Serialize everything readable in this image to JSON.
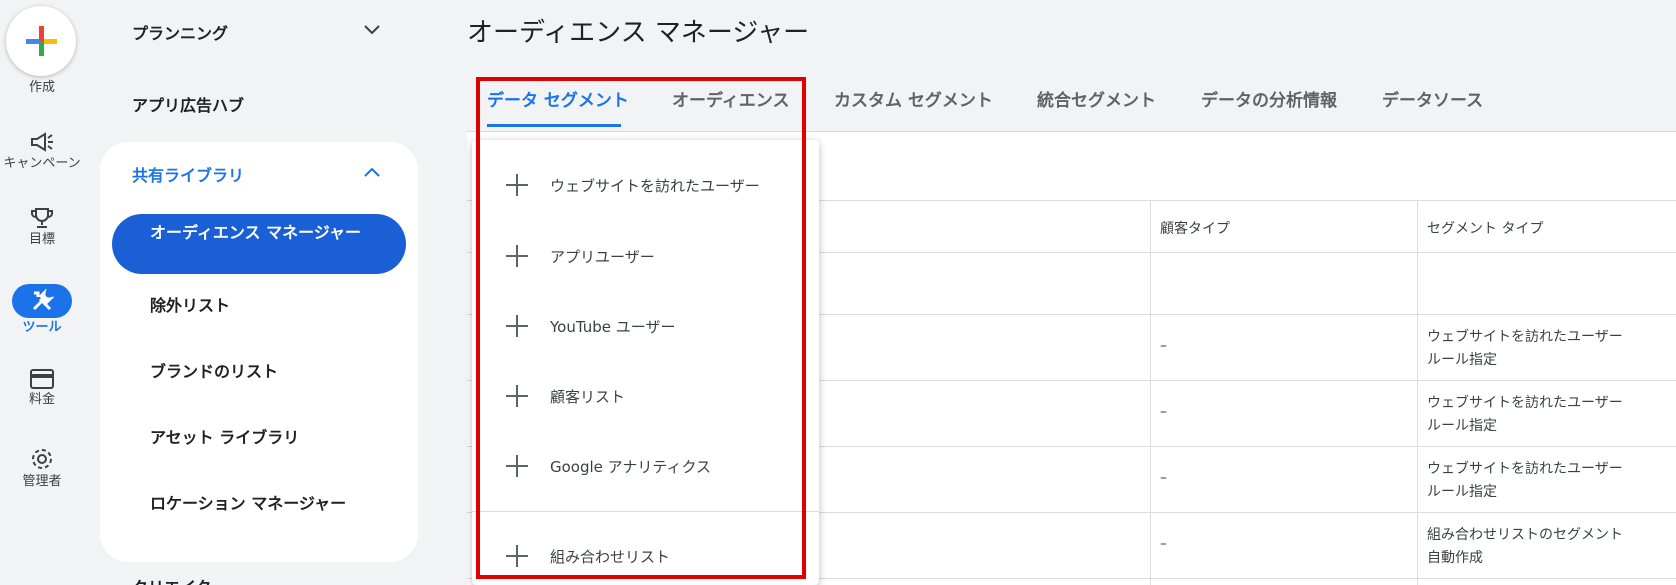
{
  "rail": {
    "create_label": "作成",
    "campaign_label": "キャンペーン",
    "goals_label": "目標",
    "tools_label": "ツール",
    "billing_label": "料金",
    "admin_label": "管理者"
  },
  "subnav": {
    "planning": "プランニング",
    "app_hub": "アプリ広告ハブ",
    "shared_library": "共有ライブラリ",
    "items": [
      "オーディエンス マネージャー",
      "除外リスト",
      "ブランドのリスト",
      "アセット ライブラリ",
      "ロケーション マネージャー"
    ],
    "next_partial": "クリエイター"
  },
  "page_title": "オーディエンス マネージャー",
  "tabs": [
    "データ セグメント",
    "オーディエンス",
    "カスタム セグメント",
    "統合セグメント",
    "データの分析情報",
    "データソース"
  ],
  "table": {
    "columns": [
      "顧客タイプ",
      "セグメント タイプ"
    ],
    "rows": [
      {
        "customer_type": "–",
        "segment_type_1": "ウェブサイトを訪れたユーザー",
        "segment_type_2": "ルール指定"
      },
      {
        "customer_type": "–",
        "segment_type_1": "ウェブサイトを訪れたユーザー",
        "segment_type_2": "ルール指定"
      },
      {
        "customer_type": "–",
        "segment_type_1": "ウェブサイトを訪れたユーザー",
        "segment_type_2": "ルール指定"
      },
      {
        "customer_type": "–",
        "segment_type_1": "組み合わせリストのセグメント",
        "segment_type_2": "自動作成"
      }
    ]
  },
  "menu": {
    "items": [
      "ウェブサイトを訪れたユーザー",
      "アプリユーザー",
      "YouTube ユーザー",
      "顧客リスト",
      "Google アナリティクス",
      "組み合わせリスト"
    ]
  },
  "colors": {
    "accent": "#1a73e8",
    "highlight": "#e00000"
  }
}
